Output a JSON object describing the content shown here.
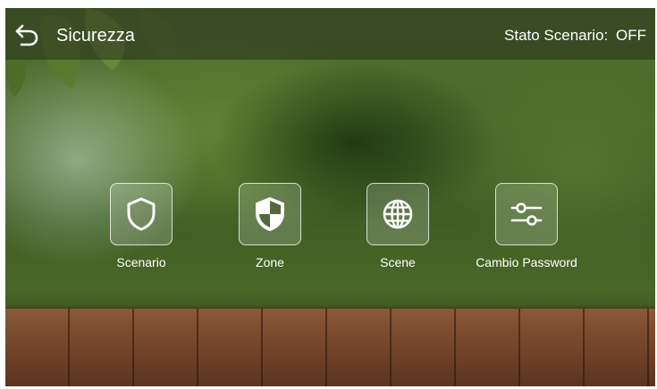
{
  "header": {
    "back_icon": "back-arrow-icon",
    "title": "Sicurezza",
    "status_label": "Stato Scenario:",
    "status_value": "OFF"
  },
  "tiles": [
    {
      "label": "Scenario",
      "icon": "shield-outline-icon"
    },
    {
      "label": "Zone",
      "icon": "shield-checkered-icon"
    },
    {
      "label": "Scene",
      "icon": "globe-icon"
    },
    {
      "label": "Cambio Password",
      "icon": "sliders-icon"
    }
  ],
  "colors": {
    "text": "#ffffff",
    "header_overlay": "#28301e",
    "wood": "#7a4a2e",
    "foliage": "#4a6a2c"
  }
}
